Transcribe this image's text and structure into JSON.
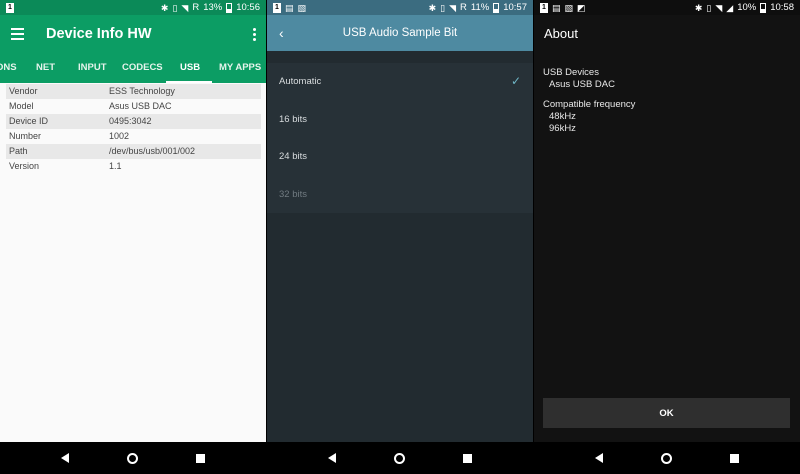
{
  "panel1": {
    "status": {
      "notif": "1",
      "network": "R",
      "battery": "13%",
      "time": "10:56"
    },
    "app_title": "Device Info HW",
    "tabs": [
      "ONS",
      "NET",
      "INPUT",
      "CODECS",
      "USB",
      "MY APPS"
    ],
    "active_tab": "USB",
    "rows": [
      {
        "key": "Vendor",
        "value": "ESS Technology"
      },
      {
        "key": "Model",
        "value": "Asus USB DAC"
      },
      {
        "key": "Device ID",
        "value": "0495:3042"
      },
      {
        "key": "Number",
        "value": "1002"
      },
      {
        "key": "Path",
        "value": "/dev/bus/usb/001/002"
      },
      {
        "key": "Version",
        "value": "1.1"
      }
    ]
  },
  "panel2": {
    "status": {
      "notif": "1",
      "network": "R",
      "battery": "11%",
      "time": "10:57"
    },
    "title": "USB Audio Sample Bit",
    "options": [
      "Automatic",
      "16 bits",
      "24 bits",
      "32 bits"
    ],
    "selected": "Automatic",
    "disabled": "32 bits"
  },
  "panel3": {
    "status": {
      "notif": "1",
      "battery": "10%",
      "time": "10:58"
    },
    "title": "About",
    "usb_devices_label": "USB Devices",
    "usb_device": "Asus USB DAC",
    "freq_label": "Compatible frequency",
    "frequencies": [
      "48kHz",
      "96kHz"
    ],
    "ok_label": "OK"
  },
  "colors": {
    "app_green": "#0c9d64",
    "dialog_header": "#4e8aa1",
    "dialog_bg": "#222b30",
    "about_bg": "#121212"
  },
  "icons": [
    "menu-icon",
    "more-vert-icon",
    "back-chevron-icon",
    "checkmark-icon",
    "bluetooth-icon",
    "wifi-icon",
    "battery-icon",
    "nav-back-icon",
    "nav-home-icon",
    "nav-recents-icon"
  ]
}
